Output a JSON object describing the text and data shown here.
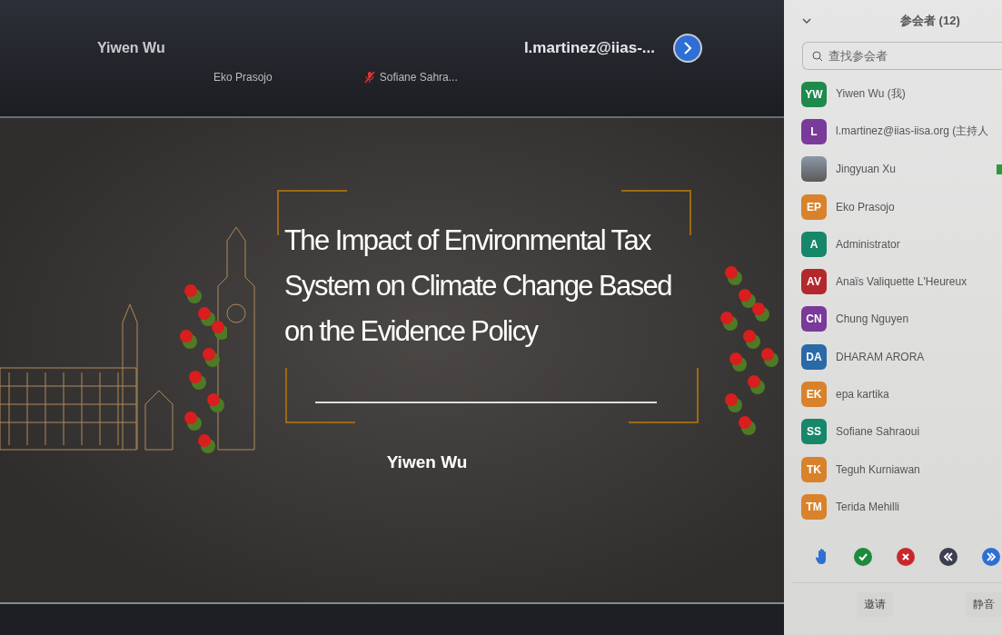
{
  "video_strip": {
    "main_tiles": [
      {
        "name": "Yiwen Wu",
        "muted": false
      },
      {
        "name": "l.martinez@iias-..."
      }
    ],
    "small_tiles": [
      {
        "name": "Eko Prasojo",
        "muted": false
      },
      {
        "name": "Sofiane Sahra...",
        "muted": true
      }
    ]
  },
  "slide": {
    "title": "The Impact of Environmental Tax System on Climate Change Based on the Evidence Policy",
    "author": "Yiwen Wu"
  },
  "participants_panel": {
    "title": "参会者 (12)",
    "search": {
      "placeholder": "查找参会者"
    },
    "participants": [
      {
        "initials": "YW",
        "name": "Yiwen Wu (我)",
        "color": "#1e8a4c",
        "kind": "initials",
        "video": false
      },
      {
        "initials": "L",
        "name": "l.martinez@iias-iisa.org (主持人",
        "color": "#7a3a9a",
        "kind": "initials",
        "video": false
      },
      {
        "name": "Jingyuan Xu",
        "kind": "photo",
        "video": true
      },
      {
        "initials": "EP",
        "name": "Eko Prasojo",
        "color": "#d9822b",
        "kind": "initials",
        "video": false
      },
      {
        "initials": "A",
        "name": "Administrator",
        "color": "#17876a",
        "kind": "initials",
        "video": false
      },
      {
        "initials": "AV",
        "name": "Anaïs Valiquette L'Heureux",
        "color": "#b3282d",
        "kind": "initials",
        "video": false
      },
      {
        "initials": "CN",
        "name": "Chung Nguyen",
        "color": "#7a3a9a",
        "kind": "initials",
        "video": false
      },
      {
        "initials": "DA",
        "name": "DHARAM ARORA",
        "color": "#2a6aa8",
        "kind": "initials",
        "video": false
      },
      {
        "initials": "EK",
        "name": "epa kartika",
        "color": "#d9822b",
        "kind": "initials",
        "video": false
      },
      {
        "initials": "SS",
        "name": "Sofiane Sahraoui",
        "color": "#17876a",
        "kind": "initials",
        "video": false
      },
      {
        "initials": "TK",
        "name": "Teguh Kurniawan",
        "color": "#d9822b",
        "kind": "initials",
        "video": false
      },
      {
        "initials": "TM",
        "name": "Terida Mehilli",
        "color": "#d9822b",
        "kind": "initials",
        "video": false
      }
    ],
    "reactions": [
      {
        "kind": "hand"
      },
      {
        "kind": "yes"
      },
      {
        "kind": "no"
      },
      {
        "kind": "slower"
      },
      {
        "kind": "faster"
      }
    ],
    "buttons": [
      "邀请",
      "静音"
    ]
  }
}
